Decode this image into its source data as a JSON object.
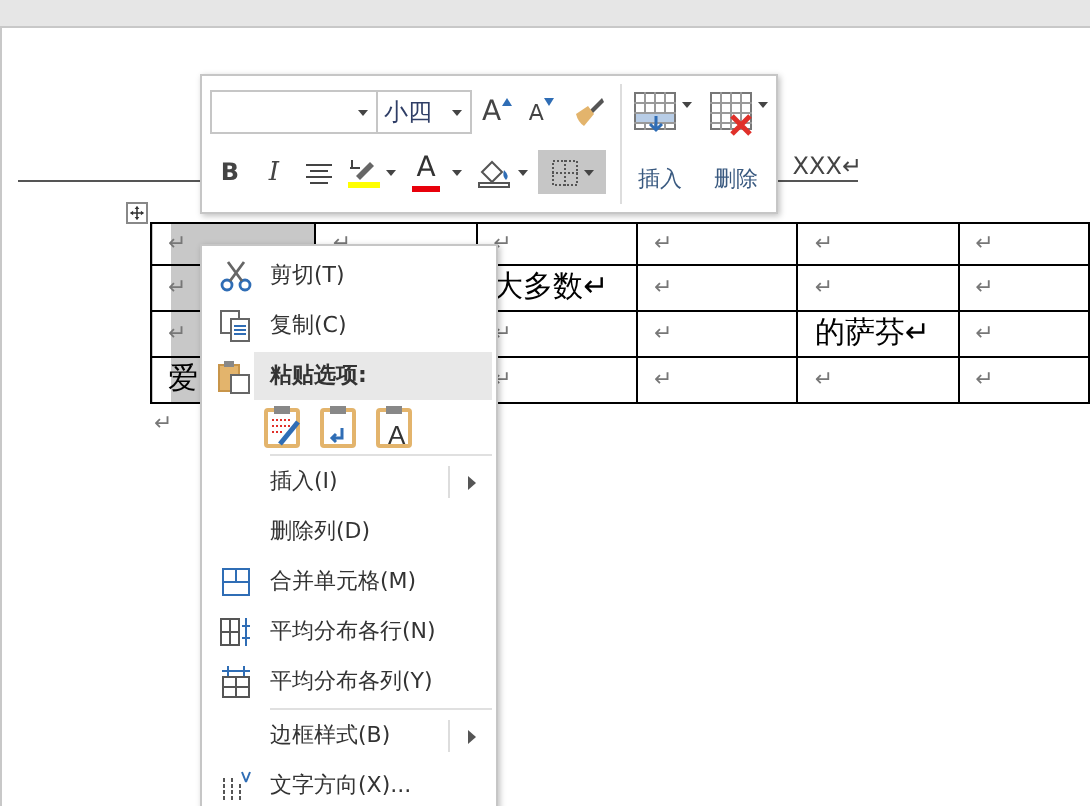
{
  "document": {
    "header_text": "XXX↵",
    "table": {
      "rows": [
        {
          "cells": [
            {
              "text": "↵",
              "selected": true
            },
            {
              "text": "↵",
              "selected": false
            },
            {
              "text": "↵",
              "selected": false
            },
            {
              "text": "↵",
              "selected": false
            },
            {
              "text": "↵",
              "selected": false
            },
            {
              "text": "↵",
              "selected": false
            }
          ]
        },
        {
          "cells": [
            {
              "text": "↵",
              "selected": true
            },
            {},
            {
              "text": "大多数↵",
              "selected": false
            },
            {
              "text": "↵",
              "selected": false
            },
            {
              "text": "↵",
              "selected": false
            },
            {
              "text": "↵",
              "selected": false
            }
          ]
        },
        {
          "cells": [
            {
              "text": "↵",
              "selected": true
            },
            {},
            {
              "text": "↵",
              "selected": false
            },
            {
              "text": "↵",
              "selected": false
            },
            {
              "text": "的萨芬↵",
              "selected": false
            },
            {
              "text": "↵",
              "selected": false
            }
          ]
        },
        {
          "cells": [
            {
              "text": "爱",
              "selected": true
            },
            {},
            {
              "text": "↵",
              "selected": false
            },
            {
              "text": "↵",
              "selected": false
            },
            {
              "text": "↵",
              "selected": false
            },
            {
              "text": "↵",
              "selected": false
            }
          ]
        }
      ]
    },
    "after_table": "↵"
  },
  "mini_toolbar": {
    "font_size": "小四",
    "row1": [
      {
        "kind": "grow",
        "label": "A",
        "selected": false
      },
      {
        "kind": "shrink",
        "label": "A",
        "selected": false
      },
      {
        "kind": "painter",
        "selected": false
      }
    ],
    "row2": [
      {
        "kind": "bold",
        "label": "B",
        "selected": false
      },
      {
        "kind": "italic",
        "label": "I",
        "selected": false
      },
      {
        "kind": "center",
        "selected": false
      },
      {
        "kind": "highlight",
        "selected": false
      },
      {
        "kind": "fontcolor",
        "label": "A",
        "selected": false
      },
      {
        "kind": "shading",
        "selected": false
      },
      {
        "kind": "borders",
        "selected": true
      }
    ],
    "table_buttons": [
      {
        "kind": "insert",
        "label": "插入"
      },
      {
        "kind": "delete",
        "label": "删除"
      }
    ]
  },
  "context_menu": {
    "items": [
      {
        "kind": "item",
        "label": "剪切(T)"
      },
      {
        "kind": "item",
        "label": "复制(C)"
      },
      {
        "kind": "header",
        "label": "粘贴选项:"
      },
      {
        "kind": "paste_row",
        "options": [
          {
            "kind": "keep"
          },
          {
            "kind": "merge"
          },
          {
            "kind": "text",
            "label": "A"
          }
        ]
      },
      {
        "kind": "separator"
      },
      {
        "kind": "item",
        "label": "插入(I)",
        "submenu": true
      },
      {
        "kind": "item",
        "label": "删除列(D)"
      },
      {
        "kind": "item",
        "label": "合并单元格(M)"
      },
      {
        "kind": "item",
        "label": "平均分布各行(N)"
      },
      {
        "kind": "item",
        "label": "平均分布各列(Y)"
      },
      {
        "kind": "separator"
      },
      {
        "kind": "item",
        "label": "边框样式(B)",
        "submenu": true
      },
      {
        "kind": "item",
        "label": "文字方向(X)..."
      }
    ]
  }
}
